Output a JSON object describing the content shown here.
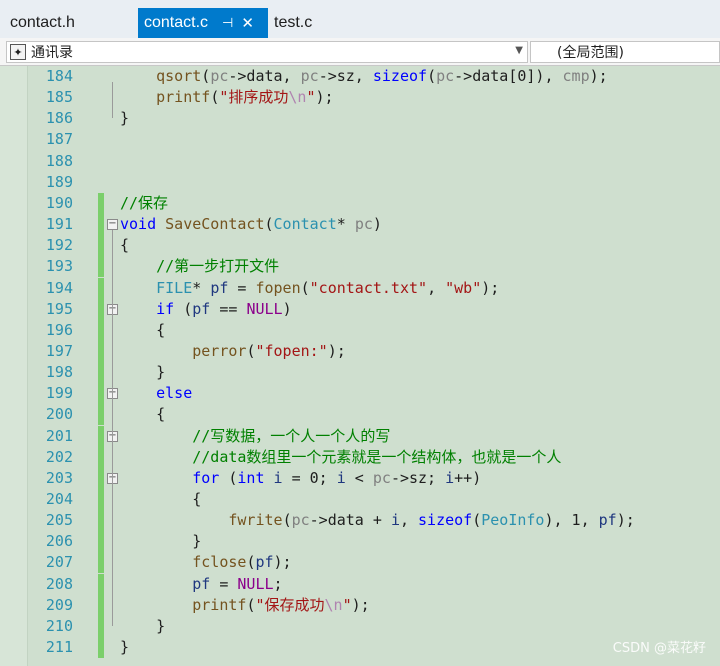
{
  "tabs": [
    {
      "label": "contact.h",
      "active": false
    },
    {
      "label": "contact.c",
      "active": true
    },
    {
      "label": "test.c",
      "active": false
    }
  ],
  "tab_icons": {
    "pin": "pin-icon",
    "close": "close-icon"
  },
  "navbar": {
    "scope": "通讯录",
    "global": "(全局范围)"
  },
  "colors": {
    "keyword": "#0000ff",
    "comment": "#008000",
    "string": "#a31515",
    "type": "#2b91af",
    "macro": "#8b008b",
    "line_number": "#2b91af",
    "active_tab": "#007acc",
    "editor_bg": "#cfdfcf",
    "change_bar": "#7bcf6b"
  },
  "code_lines": [
    {
      "n": "184",
      "fold": "",
      "changed": false,
      "tokens": [
        [
          "pl",
          "    "
        ],
        [
          "fn",
          "qsort"
        ],
        [
          "pl",
          "("
        ],
        [
          "par",
          "pc"
        ],
        [
          "pl",
          "->data, "
        ],
        [
          "par",
          "pc"
        ],
        [
          "pl",
          "->sz, "
        ],
        [
          "kw",
          "sizeof"
        ],
        [
          "pl",
          "("
        ],
        [
          "par",
          "pc"
        ],
        [
          "pl",
          "->data[0]), "
        ],
        [
          "par",
          "cmp"
        ],
        [
          "pl",
          ");"
        ]
      ]
    },
    {
      "n": "185",
      "fold": "",
      "changed": false,
      "tokens": [
        [
          "pl",
          "    "
        ],
        [
          "fn",
          "printf"
        ],
        [
          "pl",
          "("
        ],
        [
          "str",
          "\"排序成功"
        ],
        [
          "esc",
          "\\n"
        ],
        [
          "str",
          "\""
        ],
        [
          "pl",
          ");"
        ]
      ]
    },
    {
      "n": "186",
      "fold": "",
      "changed": false,
      "tokens": [
        [
          "pl",
          "}"
        ]
      ]
    },
    {
      "n": "187",
      "fold": "",
      "changed": false,
      "tokens": []
    },
    {
      "n": "188",
      "fold": "",
      "changed": false,
      "tokens": []
    },
    {
      "n": "189",
      "fold": "",
      "changed": false,
      "tokens": []
    },
    {
      "n": "190",
      "fold": "",
      "changed": true,
      "tokens": [
        [
          "cm",
          "//保存"
        ]
      ]
    },
    {
      "n": "191",
      "fold": "minus",
      "changed": true,
      "tokens": [
        [
          "kw",
          "void"
        ],
        [
          "pl",
          " "
        ],
        [
          "fn",
          "SaveContact"
        ],
        [
          "pl",
          "("
        ],
        [
          "ty",
          "Contact"
        ],
        [
          "pl",
          "* "
        ],
        [
          "par",
          "pc"
        ],
        [
          "pl",
          ")"
        ]
      ]
    },
    {
      "n": "192",
      "fold": "",
      "changed": true,
      "tokens": [
        [
          "pl",
          "{"
        ]
      ]
    },
    {
      "n": "193",
      "fold": "",
      "changed": true,
      "tokens": [
        [
          "pl",
          "    "
        ],
        [
          "cm",
          "//第一步打开文件"
        ]
      ]
    },
    {
      "n": "194",
      "fold": "",
      "changed": true,
      "tokens": [
        [
          "pl",
          "    "
        ],
        [
          "ty",
          "FILE"
        ],
        [
          "pl",
          "* "
        ],
        [
          "id",
          "pf"
        ],
        [
          "pl",
          " = "
        ],
        [
          "fn",
          "fopen"
        ],
        [
          "pl",
          "("
        ],
        [
          "str",
          "\"contact.txt\""
        ],
        [
          "pl",
          ", "
        ],
        [
          "str",
          "\"wb\""
        ],
        [
          "pl",
          ");"
        ]
      ]
    },
    {
      "n": "195",
      "fold": "minus",
      "changed": true,
      "tokens": [
        [
          "pl",
          "    "
        ],
        [
          "kw",
          "if"
        ],
        [
          "pl",
          " ("
        ],
        [
          "id",
          "pf"
        ],
        [
          "pl",
          " == "
        ],
        [
          "mac",
          "NULL"
        ],
        [
          "pl",
          ")"
        ]
      ]
    },
    {
      "n": "196",
      "fold": "",
      "changed": true,
      "tokens": [
        [
          "pl",
          "    {"
        ]
      ]
    },
    {
      "n": "197",
      "fold": "",
      "changed": true,
      "tokens": [
        [
          "pl",
          "        "
        ],
        [
          "fn",
          "perror"
        ],
        [
          "pl",
          "("
        ],
        [
          "str",
          "\"fopen:\""
        ],
        [
          "pl",
          ");"
        ]
      ]
    },
    {
      "n": "198",
      "fold": "",
      "changed": true,
      "tokens": [
        [
          "pl",
          "    }"
        ]
      ]
    },
    {
      "n": "199",
      "fold": "minus",
      "changed": true,
      "tokens": [
        [
          "pl",
          "    "
        ],
        [
          "kw",
          "else"
        ]
      ]
    },
    {
      "n": "200",
      "fold": "",
      "changed": true,
      "tokens": [
        [
          "pl",
          "    {"
        ]
      ]
    },
    {
      "n": "201",
      "fold": "minus",
      "changed": true,
      "tokens": [
        [
          "pl",
          "        "
        ],
        [
          "cm",
          "//写数据，一个人一个人的写"
        ]
      ]
    },
    {
      "n": "202",
      "fold": "",
      "changed": true,
      "tokens": [
        [
          "pl",
          "        "
        ],
        [
          "cm",
          "//data数组里一个元素就是一个结构体，也就是一个人"
        ]
      ]
    },
    {
      "n": "203",
      "fold": "minus",
      "changed": true,
      "tokens": [
        [
          "pl",
          "        "
        ],
        [
          "kw",
          "for"
        ],
        [
          "pl",
          " ("
        ],
        [
          "kw",
          "int"
        ],
        [
          "pl",
          " "
        ],
        [
          "id",
          "i"
        ],
        [
          "pl",
          " = 0; "
        ],
        [
          "id",
          "i"
        ],
        [
          "pl",
          " < "
        ],
        [
          "par",
          "pc"
        ],
        [
          "pl",
          "->sz; "
        ],
        [
          "id",
          "i"
        ],
        [
          "pl",
          "++)"
        ]
      ]
    },
    {
      "n": "204",
      "fold": "",
      "changed": true,
      "tokens": [
        [
          "pl",
          "        {"
        ]
      ]
    },
    {
      "n": "205",
      "fold": "",
      "changed": true,
      "tokens": [
        [
          "pl",
          "            "
        ],
        [
          "fn",
          "fwrite"
        ],
        [
          "pl",
          "("
        ],
        [
          "par",
          "pc"
        ],
        [
          "pl",
          "->data + "
        ],
        [
          "id",
          "i"
        ],
        [
          "pl",
          ", "
        ],
        [
          "kw",
          "sizeof"
        ],
        [
          "pl",
          "("
        ],
        [
          "ty",
          "PeoInfo"
        ],
        [
          "pl",
          "), 1, "
        ],
        [
          "id",
          "pf"
        ],
        [
          "pl",
          ");"
        ]
      ]
    },
    {
      "n": "206",
      "fold": "",
      "changed": true,
      "tokens": [
        [
          "pl",
          "        }"
        ]
      ]
    },
    {
      "n": "207",
      "fold": "",
      "changed": true,
      "tokens": [
        [
          "pl",
          "        "
        ],
        [
          "fn",
          "fclose"
        ],
        [
          "pl",
          "("
        ],
        [
          "id",
          "pf"
        ],
        [
          "pl",
          ");"
        ]
      ]
    },
    {
      "n": "208",
      "fold": "",
      "changed": true,
      "tokens": [
        [
          "pl",
          "        "
        ],
        [
          "id",
          "pf"
        ],
        [
          "pl",
          " = "
        ],
        [
          "mac",
          "NULL"
        ],
        [
          "pl",
          ";"
        ]
      ]
    },
    {
      "n": "209",
      "fold": "",
      "changed": true,
      "tokens": [
        [
          "pl",
          "        "
        ],
        [
          "fn",
          "printf"
        ],
        [
          "pl",
          "("
        ],
        [
          "str",
          "\"保存成功"
        ],
        [
          "esc",
          "\\n"
        ],
        [
          "str",
          "\""
        ],
        [
          "pl",
          ");"
        ]
      ]
    },
    {
      "n": "210",
      "fold": "",
      "changed": true,
      "tokens": [
        [
          "pl",
          "    }"
        ]
      ]
    },
    {
      "n": "211",
      "fold": "",
      "changed": true,
      "tokens": [
        [
          "pl",
          "}"
        ]
      ]
    }
  ],
  "watermark": "CSDN @菜花籽"
}
